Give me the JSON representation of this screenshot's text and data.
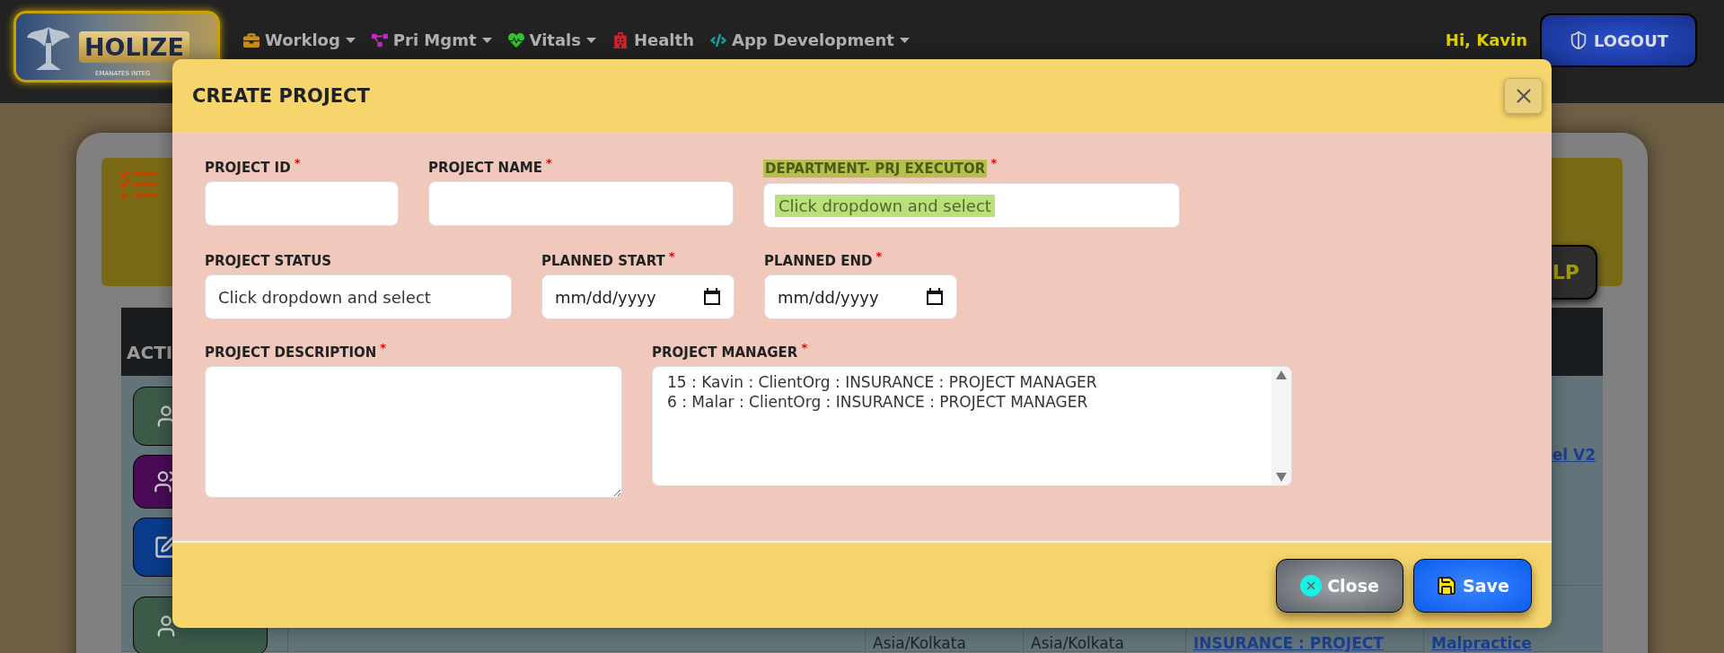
{
  "nav": {
    "logo": {
      "name": "HOLIZE",
      "tagline": "EMANATES INTEG"
    },
    "items": [
      {
        "label": "Worklog",
        "dropdown": true
      },
      {
        "label": "Pri Mgmt",
        "dropdown": true
      },
      {
        "label": "Vitals",
        "dropdown": true
      },
      {
        "label": "Health",
        "dropdown": false
      },
      {
        "label": "App Development",
        "dropdown": true
      }
    ],
    "greeting": "Hi, Kavin",
    "logout": "LOGOUT"
  },
  "background_page": {
    "help_button": "LP",
    "table_header": "ACTI",
    "rows": [
      {
        "actions": [
          {
            "kind": "view"
          },
          {
            "kind": "members"
          },
          {
            "kind": "edit"
          }
        ],
        "cells": [],
        "links": [
          "el V2"
        ]
      },
      {
        "actions": [
          {
            "kind": "view"
          }
        ],
        "cells": [
          "Asia/Kolkata",
          "Asia/Kolkata"
        ],
        "links": [
          "INSURANCE : PROJECT",
          "Malpractice"
        ]
      }
    ]
  },
  "modal": {
    "title": "CREATE PROJECT",
    "required_mark": "*",
    "rows": [
      [
        {
          "label": "PROJECT ID",
          "kind": "text",
          "required": true
        },
        {
          "label": "PROJECT NAME",
          "kind": "text",
          "required": true
        },
        {
          "label": "DEPARTMENT- PRJ EXECUTOR",
          "kind": "select",
          "required": true,
          "value": "Click dropdown and select",
          "highlighted": true
        }
      ],
      [
        {
          "label": "PROJECT STATUS",
          "kind": "select",
          "required": false,
          "value": "Click dropdown and select",
          "highlighted": false
        },
        {
          "label": "PLANNED START",
          "kind": "date",
          "required": true,
          "placeholder": "mm/dd/yyyy"
        },
        {
          "label": "PLANNED END",
          "kind": "date",
          "required": true,
          "placeholder": "mm/dd/yyyy"
        }
      ],
      [
        {
          "label": "PROJECT DESCRIPTION",
          "kind": "textarea",
          "required": true
        },
        {
          "label": "PROJECT MANAGER",
          "kind": "listbox",
          "required": true,
          "options": [
            {
              "label": "15 : Kavin : ClientOrg : INSURANCE : PROJECT MANAGER",
              "selected": false
            },
            {
              "label": "6 : Malar : ClientOrg : INSURANCE : PROJECT MANAGER",
              "selected": false
            }
          ]
        }
      ]
    ],
    "buttons": [
      {
        "label": "Close",
        "kind": "close"
      },
      {
        "label": "Save",
        "kind": "save"
      }
    ]
  }
}
